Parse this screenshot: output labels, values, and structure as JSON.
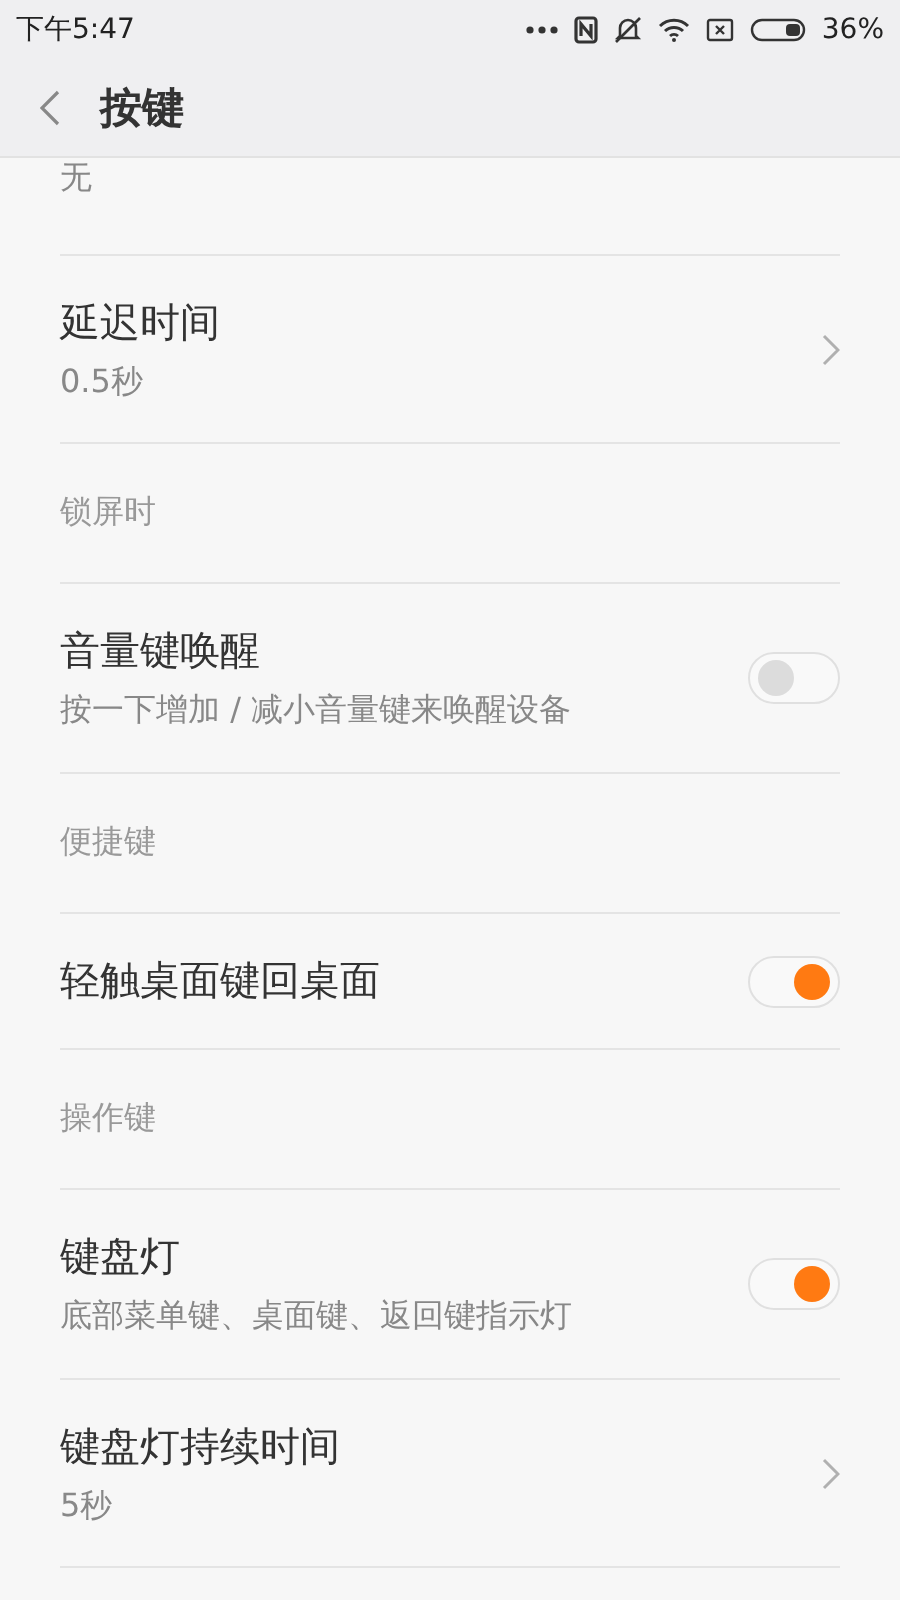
{
  "status_bar": {
    "time": "下午5:47",
    "battery_text": "36%"
  },
  "header": {
    "title": "按键"
  },
  "items": [
    {
      "kind": "nav",
      "subtitle": "无"
    },
    {
      "kind": "nav",
      "title": "延迟时间",
      "subtitle": "0.5秒"
    },
    {
      "kind": "section",
      "title": "锁屏时"
    },
    {
      "kind": "switch",
      "title": "音量键唤醒",
      "subtitle": "按一下增加 / 减小音量键来唤醒设备",
      "on": false
    },
    {
      "kind": "section",
      "title": "便捷键"
    },
    {
      "kind": "switch",
      "title": "轻触桌面键回桌面",
      "on": true
    },
    {
      "kind": "section",
      "title": "操作键"
    },
    {
      "kind": "switch",
      "title": "键盘灯",
      "subtitle": "底部菜单键、桌面键、返回键指示灯",
      "on": true
    },
    {
      "kind": "nav",
      "title": "键盘灯持续时间",
      "subtitle": "5秒"
    }
  ]
}
